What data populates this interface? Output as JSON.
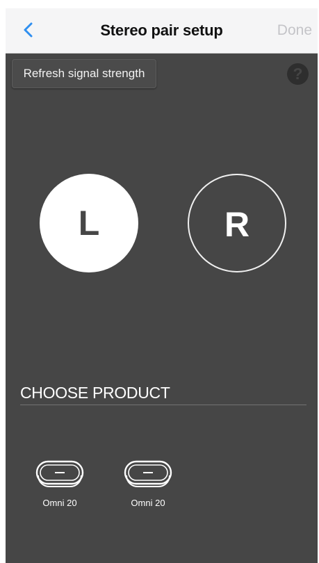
{
  "navbar": {
    "title": "Stereo pair setup",
    "done_label": "Done",
    "back_icon": "chevron-left-icon",
    "accent_color": "#2f8ff0"
  },
  "toolbar": {
    "refresh_label": "Refresh signal strength",
    "help_label": "?"
  },
  "speakers": {
    "left": {
      "label": "L",
      "state": "selected"
    },
    "right": {
      "label": "R",
      "state": "unselected"
    }
  },
  "choose_product": {
    "title": "CHOOSE PRODUCT",
    "products": [
      {
        "name": "Omni 20",
        "icon": "speaker-device-icon"
      },
      {
        "name": "Omni 20",
        "icon": "speaker-device-icon"
      }
    ]
  },
  "colors": {
    "background": "#464646",
    "navbar_background": "#f5f5f6",
    "done_disabled": "#c4c4c8"
  }
}
